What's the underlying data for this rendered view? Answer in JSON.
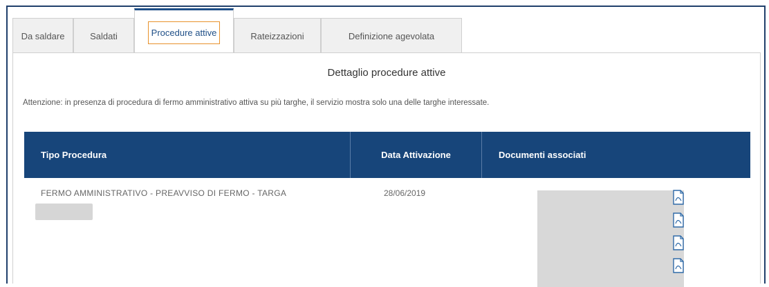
{
  "tabs": [
    {
      "label": "Da saldare",
      "active": false
    },
    {
      "label": "Saldati",
      "active": false
    },
    {
      "label": "Procedure attive",
      "active": true
    },
    {
      "label": "Rateizzazioni",
      "active": false
    },
    {
      "label": "Definizione agevolata",
      "active": false
    }
  ],
  "panel": {
    "title": "Dettaglio procedure attive",
    "notice": "Attenzione: in presenza di procedura di fermo amministrativo attiva su più targhe, il servizio mostra solo una delle targhe interessate."
  },
  "table": {
    "headers": [
      "Tipo Procedura",
      "Data Attivazione",
      "Documenti associati"
    ],
    "rows": [
      {
        "tipo": "FERMO AMMINISTRATIVO - PREAVVISO DI FERMO - TARGA",
        "data": "28/06/2019",
        "documenti": [
          "document-icon",
          "document-icon",
          "document-icon",
          "document-icon"
        ]
      }
    ]
  },
  "colors": {
    "header_bg": "#17457a",
    "active_tab_border": "#1f4f87",
    "focus_outline": "#e8912b"
  }
}
